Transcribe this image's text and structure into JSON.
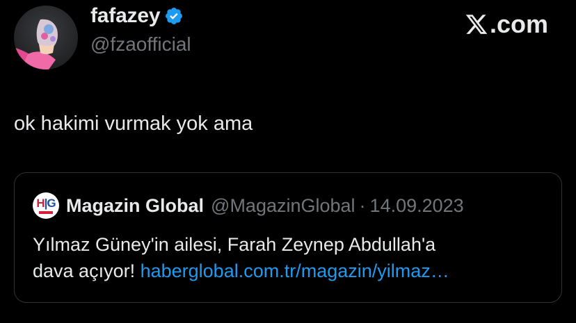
{
  "author": {
    "display_name": "fafazey",
    "handle": "@fzaofficial",
    "verified": true
  },
  "brand": {
    "domain_suffix": ".com"
  },
  "tweet": {
    "text": "ok hakimi vurmak yok ama"
  },
  "quoted_tweet": {
    "display_name": "Magazin Global",
    "handle": "@MagazinGlobal",
    "separator": "·",
    "date": "14.09.2023",
    "body_line1": "Yılmaz Güney'in ailesi, Farah Zeynep Abdullah'a",
    "body_line2_prefix": "dava açıyor!",
    "link": "haberglobal.com.tr/magazin/yilmaz…"
  },
  "colors": {
    "background": "#000000",
    "text_primary": "#e7e9ea",
    "text_secondary": "#71767b",
    "link": "#1d9bf0",
    "verified": "#1d9bf0",
    "border": "#2f3336"
  },
  "icons": {
    "verified": "verified-badge-icon",
    "site": "x-logo-icon",
    "quote_avatar": "haber-global-logo-icon"
  }
}
